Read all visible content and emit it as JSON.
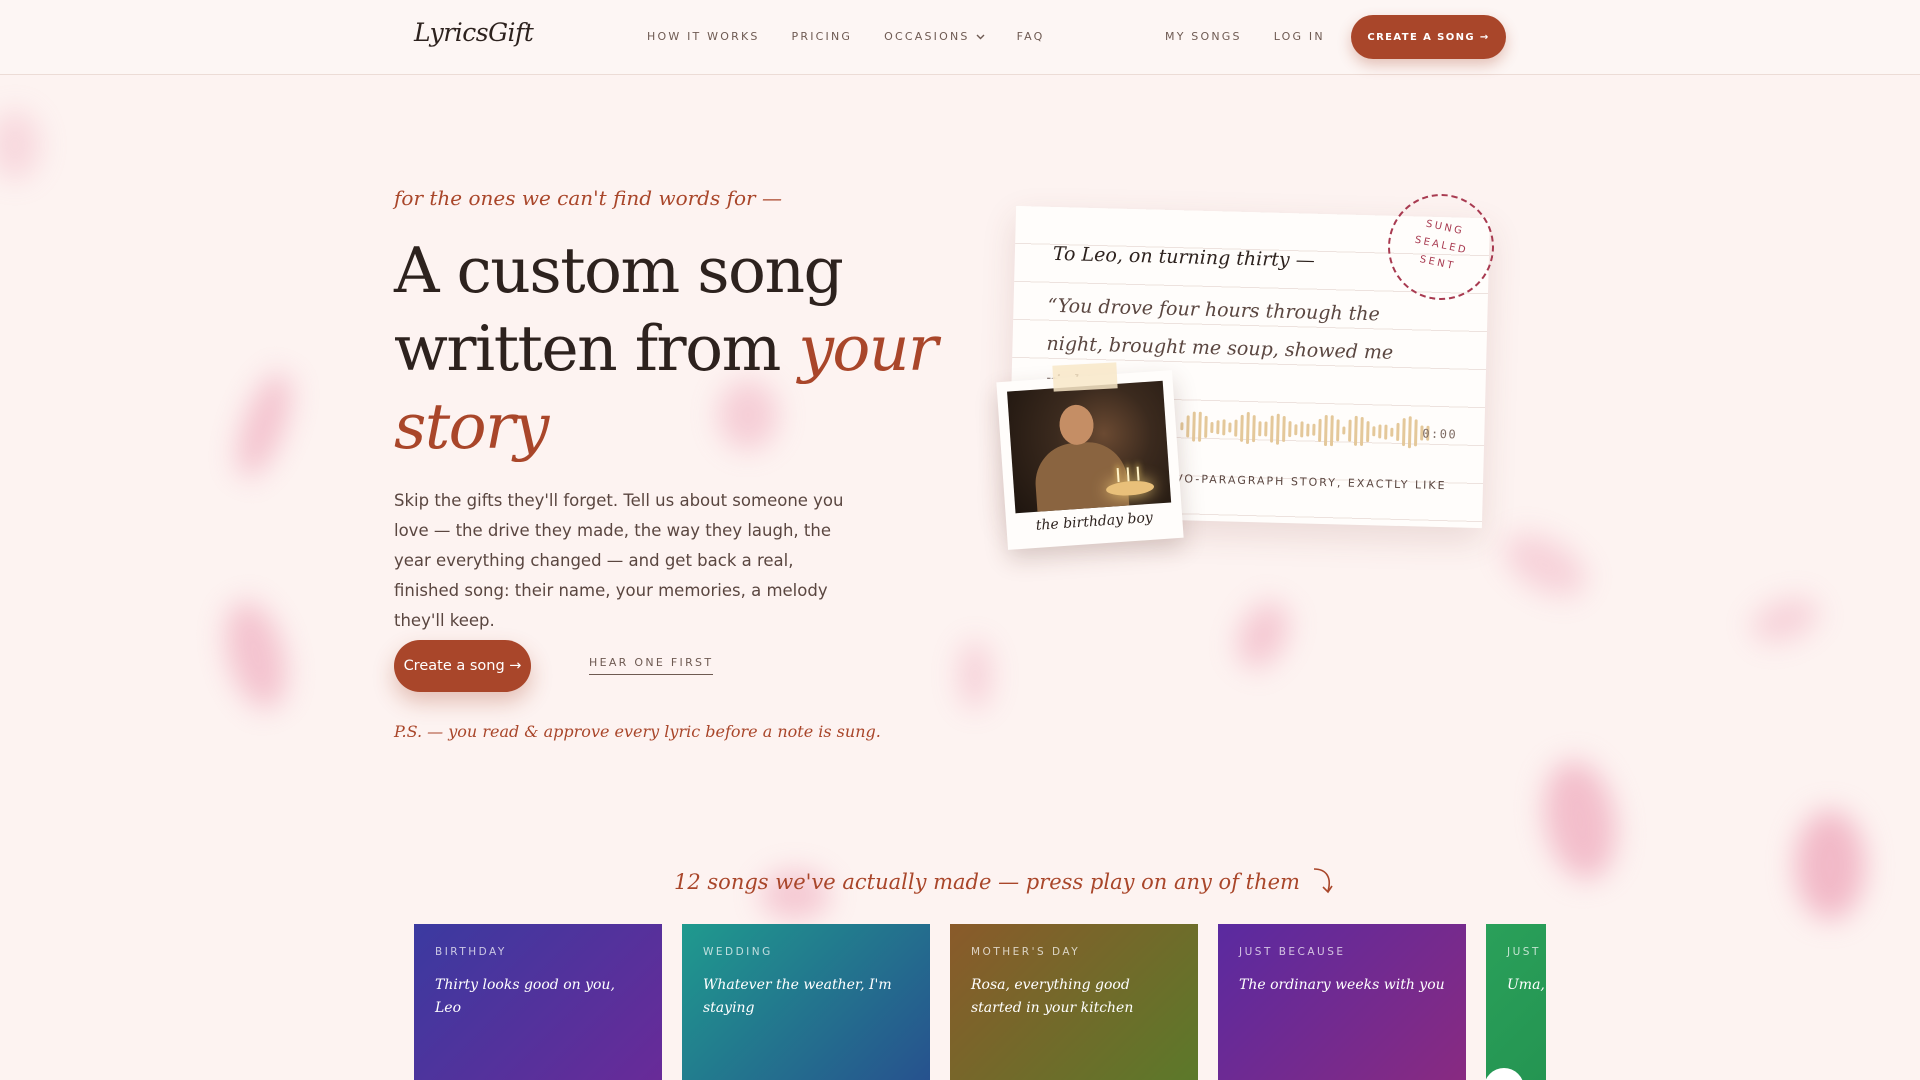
{
  "nav": {
    "logo": "LyricsGift",
    "links": [
      "HOW IT WORKS",
      "PRICING",
      "OCCASIONS",
      "FAQ"
    ],
    "right_links": [
      "MY SONGS",
      "LOG IN"
    ],
    "cta": "CREATE A SONG →"
  },
  "hero": {
    "tagline": "for the ones we can't find words for —",
    "title_1": "A custom song",
    "title_2": "written from ",
    "title_em": "your story",
    "lead": "Skip the gifts they'll forget. Tell us about someone you love — the drive they made, the way they laugh, the year everything changed — and get back a real, finished song: their name, your memories, a melody they'll keep.",
    "cta": "Create a song →",
    "secondary": "HEAR ONE FIRST",
    "ps": "P.S. — you read & approve every lyric before a note is sung."
  },
  "letter": {
    "to": "To Leo, on turning thirty —",
    "quote": "“You drove four hours through the night, brought me soup, showed me right...”",
    "time": "0:00",
    "footer": "VO-PARAGRAPH STORY, EXACTLY LIKE",
    "stamp": [
      "SUNG",
      "SEALED",
      "SENT"
    ],
    "photo_caption": "the birthday boy"
  },
  "songs": {
    "heading": "12 songs we've actually made — press play on any of them",
    "items": [
      {
        "occasion": "BIRTHDAY",
        "title": "Thirty looks good on you, Leo",
        "gradient": [
          "#3b3aa0",
          "#6a2a98"
        ]
      },
      {
        "occasion": "WEDDING",
        "title": "Whatever the weather, I'm staying",
        "gradient": [
          "#1f9a8e",
          "#274f8e"
        ]
      },
      {
        "occasion": "MOTHER'S DAY",
        "title": "Rosa, everything good started in your kitchen",
        "gradient": [
          "#8a5a2a",
          "#5a7a2a"
        ]
      },
      {
        "occasion": "JUST BECAUSE",
        "title": "The ordinary weeks with you",
        "gradient": [
          "#5a2aa0",
          "#8a2a80"
        ]
      },
      {
        "occasion": "JUST BECAUSE",
        "title": "Uma, t",
        "gradient": [
          "#2aa05a",
          "#1f8a4a"
        ]
      }
    ]
  }
}
